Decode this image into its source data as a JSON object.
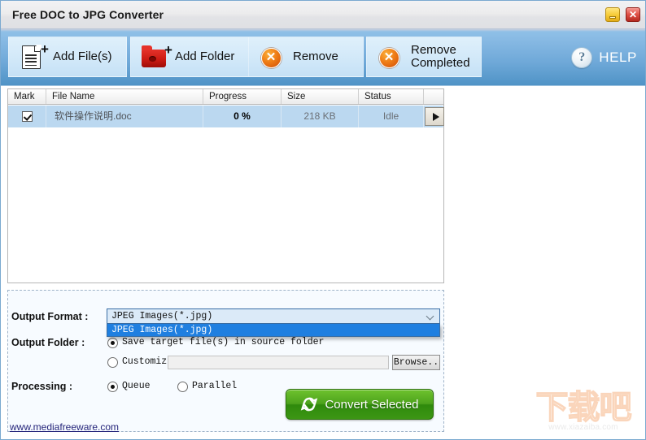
{
  "window": {
    "title": "Free DOC to JPG Converter",
    "minimize_label": "–",
    "close_label": "✕"
  },
  "toolbar": {
    "add_files_label": "Add File(s)",
    "add_folder_label": "Add Folder",
    "remove_label": "Remove",
    "remove_completed_label": "Remove\nCompleted",
    "help_label": "HELP",
    "help_icon_glyph": "?",
    "x_glyph": "✕",
    "plus_glyph": "+"
  },
  "file_list": {
    "columns": [
      {
        "key": "mark",
        "label": "Mark"
      },
      {
        "key": "name",
        "label": "File Name"
      },
      {
        "key": "prog",
        "label": "Progress"
      },
      {
        "key": "size",
        "label": "Size"
      },
      {
        "key": "status",
        "label": "Status"
      },
      {
        "key": "action",
        "label": ""
      }
    ],
    "rows": [
      {
        "checked": true,
        "name": "软件操作说明.doc",
        "progress": "0 %",
        "size": "218 KB",
        "status": "Idle"
      }
    ]
  },
  "settings": {
    "output_format_label": "Output Format :",
    "output_folder_label": "Output Folder :",
    "processing_label": "Processing :",
    "format_selected": "JPEG Images(*.jpg)",
    "format_options": [
      "JPEG Images(*.jpg)"
    ],
    "save_in_source_label": "Save target file(s) in source folder",
    "customize_label": "Customize",
    "customize_path": "",
    "browse_label": "Browse..",
    "queue_label": "Queue",
    "parallel_label": "Parallel"
  },
  "actions": {
    "convert_label": "Convert Selected"
  },
  "footer": {
    "website": "www.mediafreeware.com"
  },
  "watermark": {
    "logo_text": "下载吧",
    "url_text": "www.xiazaiba.com"
  },
  "colors": {
    "toolbar_top": "#8fc0e7",
    "toolbar_bottom": "#4f93c6",
    "row_selected": "#bbd8f0",
    "dropdown_highlight": "#1f7fe0",
    "convert_green": "#4da31c",
    "link_blue": "#24247a"
  }
}
